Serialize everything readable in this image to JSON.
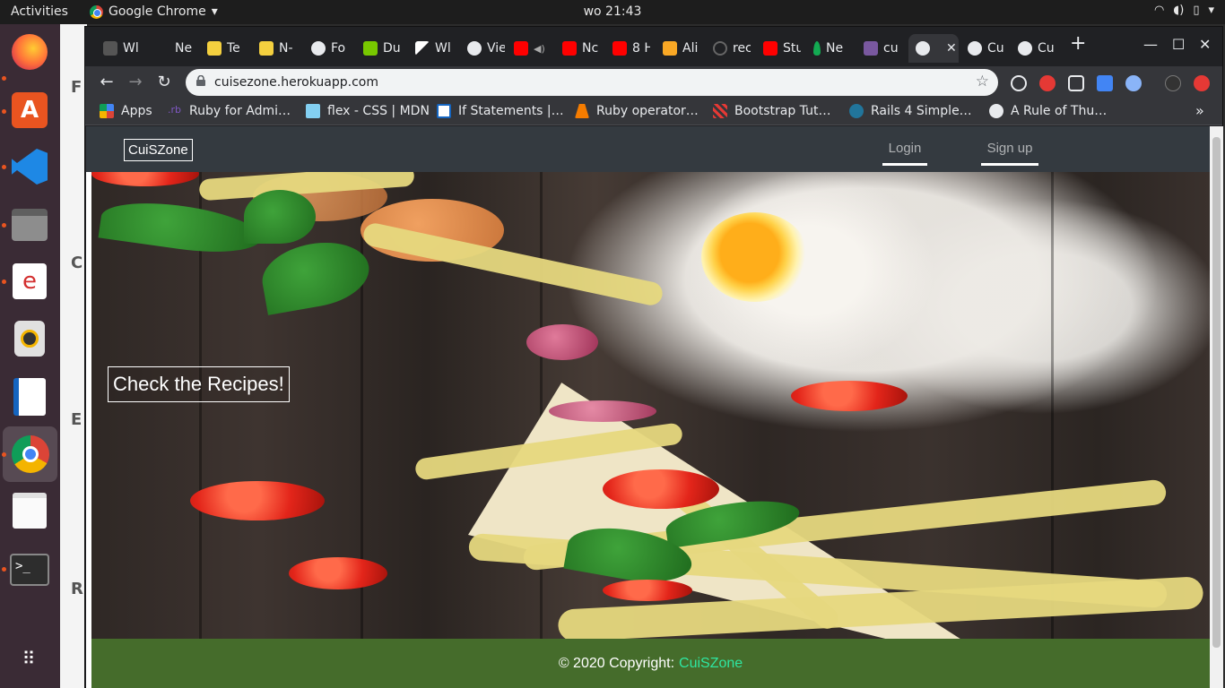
{
  "desktop": {
    "activities": "Activities",
    "app_name": "Google Chrome",
    "clock": "wo 21:43"
  },
  "browser": {
    "tabs": [
      "Wl",
      "Ne",
      "Te",
      "N-",
      "Fo",
      "Du",
      "Wl",
      "Vie",
      "",
      "Nc",
      "8 H",
      "Ali",
      "rec",
      "Stu",
      "Ne",
      "cu",
      "",
      "Cu",
      "Cu"
    ],
    "new_tab": "+",
    "url": "cuisezone.herokuapp.com",
    "bookmarks": [
      "Apps",
      "Ruby for Admi…",
      "flex - CSS | MDN",
      "If Statements |…",
      "Ruby operator…",
      "Bootstrap Tut…",
      "Rails 4 Simple…",
      "A Rule of Thu…"
    ],
    "bookmarks_overflow": "»"
  },
  "site": {
    "brand": "CuiSZone",
    "nav": {
      "login": "Login",
      "signup": "Sign up"
    },
    "hero": {
      "cta": "Check the Recipes!"
    },
    "footer": {
      "copyright": "© 2020 Copyright:",
      "brand": "CuiSZone"
    }
  },
  "colors": {
    "navbar": "#343a40",
    "footer": "#456c2b",
    "footer_link": "#2fe6a0",
    "dock": "#3a2b35",
    "chrome_frame": "#202124"
  }
}
